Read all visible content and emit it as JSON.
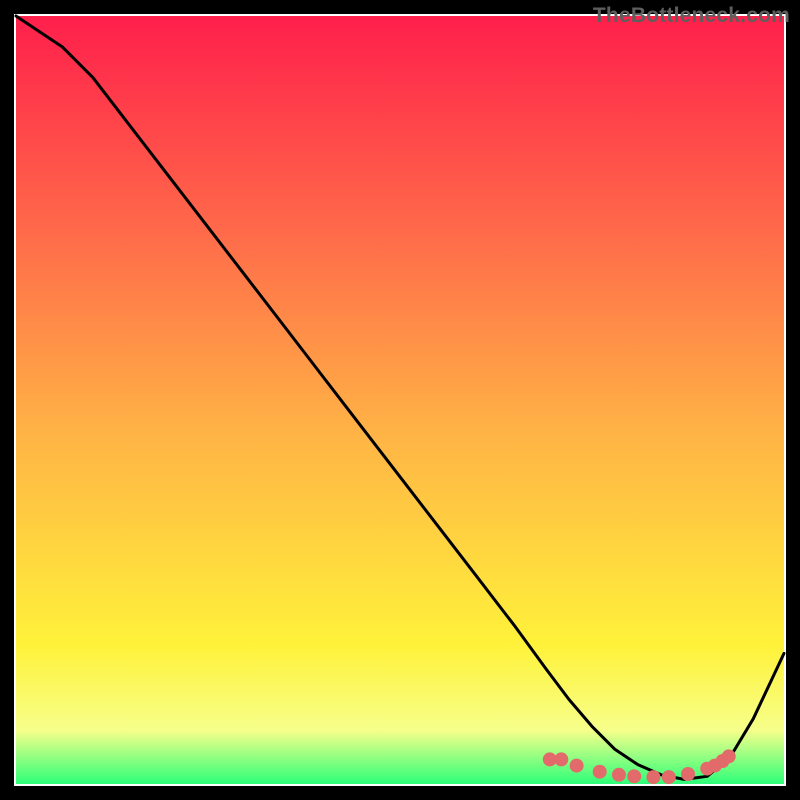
{
  "watermark": "TheBottleneck.com",
  "chart_data": {
    "type": "line",
    "title": "",
    "xlabel": "",
    "ylabel": "",
    "xlim": [
      0,
      100
    ],
    "ylim": [
      0,
      100
    ],
    "grid": false,
    "series": [
      {
        "name": "black-curve",
        "x": [
          0,
          3,
          6,
          10,
          15,
          20,
          25,
          30,
          35,
          40,
          45,
          50,
          55,
          60,
          65,
          69,
          72,
          75,
          78,
          81,
          84,
          87,
          90,
          93,
          96,
          100
        ],
        "y": [
          100,
          98,
          96,
          92,
          85.5,
          79,
          72.5,
          66,
          59.5,
          53,
          46.5,
          40,
          33.5,
          27,
          20.5,
          15,
          11,
          7.5,
          4.5,
          2.5,
          1.2,
          0.6,
          1.0,
          3.5,
          8.5,
          17
        ]
      },
      {
        "name": "bottom-band",
        "x": [
          0,
          100
        ],
        "y": [
          4,
          4
        ]
      }
    ],
    "dots": {
      "name": "sweet-spot-markers",
      "color": "#e36a6a",
      "points": [
        {
          "x": 69.5,
          "y": 3.2
        },
        {
          "x": 71.0,
          "y": 3.2
        },
        {
          "x": 73.0,
          "y": 2.4
        },
        {
          "x": 76.0,
          "y": 1.6
        },
        {
          "x": 78.5,
          "y": 1.2
        },
        {
          "x": 80.5,
          "y": 1.0
        },
        {
          "x": 83.0,
          "y": 0.9
        },
        {
          "x": 85.0,
          "y": 0.9
        },
        {
          "x": 87.5,
          "y": 1.3
        },
        {
          "x": 90.0,
          "y": 2.0
        },
        {
          "x": 91.0,
          "y": 2.4
        },
        {
          "x": 92.0,
          "y": 3.0
        },
        {
          "x": 92.8,
          "y": 3.6
        }
      ]
    },
    "colors": {
      "gradient_top": "#ff1f4b",
      "gradient_mid_upper": "#ff6a4a",
      "gradient_mid": "#ffb545",
      "gradient_lower": "#fff23a",
      "gradient_bottom_band": "#f6ff8a",
      "gradient_bottom": "#2dff79",
      "curve": "#000000",
      "dots": "#e36a6a"
    }
  }
}
